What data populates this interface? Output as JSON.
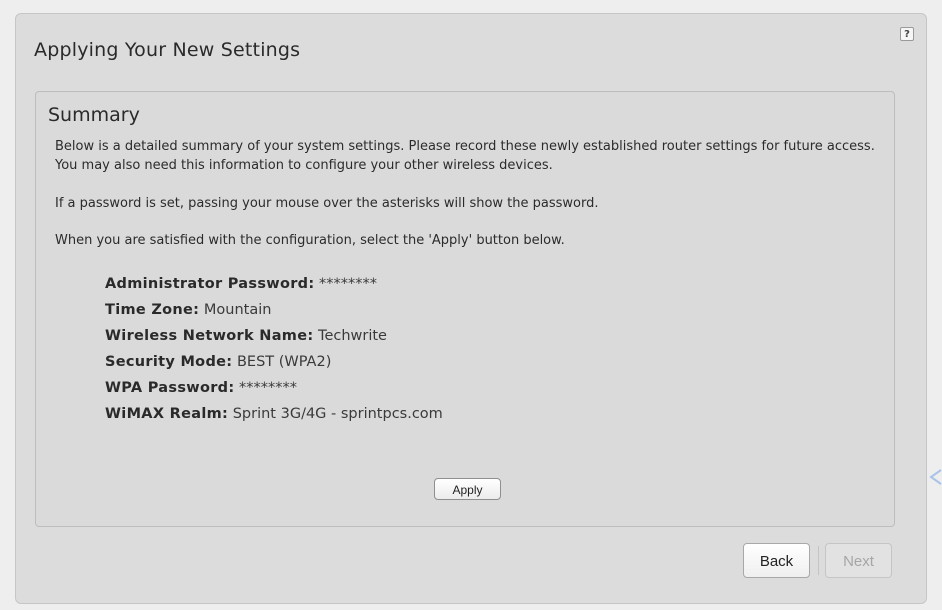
{
  "help": {
    "label": "?"
  },
  "page": {
    "title": "Applying Your New Settings"
  },
  "summary": {
    "heading": "Summary",
    "paragraphs": [
      "Below is a detailed summary of your system settings. Please record these newly established router settings for future access. You may also need this information to configure your other wireless devices.",
      "If a password is set, passing your mouse over the asterisks will show the password.",
      "When you are satisfied with the configuration, select the 'Apply' button below."
    ],
    "settings": [
      {
        "label": "Administrator Password:",
        "value": "********"
      },
      {
        "label": "Time Zone:",
        "value": "Mountain"
      },
      {
        "label": "Wireless Network Name:",
        "value": "Techwrite"
      },
      {
        "label": "Security Mode:",
        "value": "BEST (WPA2)"
      },
      {
        "label": "WPA Password:",
        "value": "********"
      },
      {
        "label": "WiMAX Realm:",
        "value": "Sprint 3G/4G - sprintpcs.com"
      }
    ],
    "apply_label": "Apply"
  },
  "nav": {
    "back_label": "Back",
    "next_label": "Next"
  },
  "colors": {
    "panel_bg": "#dcdcdc",
    "page_bg": "#eeeeee",
    "arrow_accent": "#a9c4e8"
  }
}
